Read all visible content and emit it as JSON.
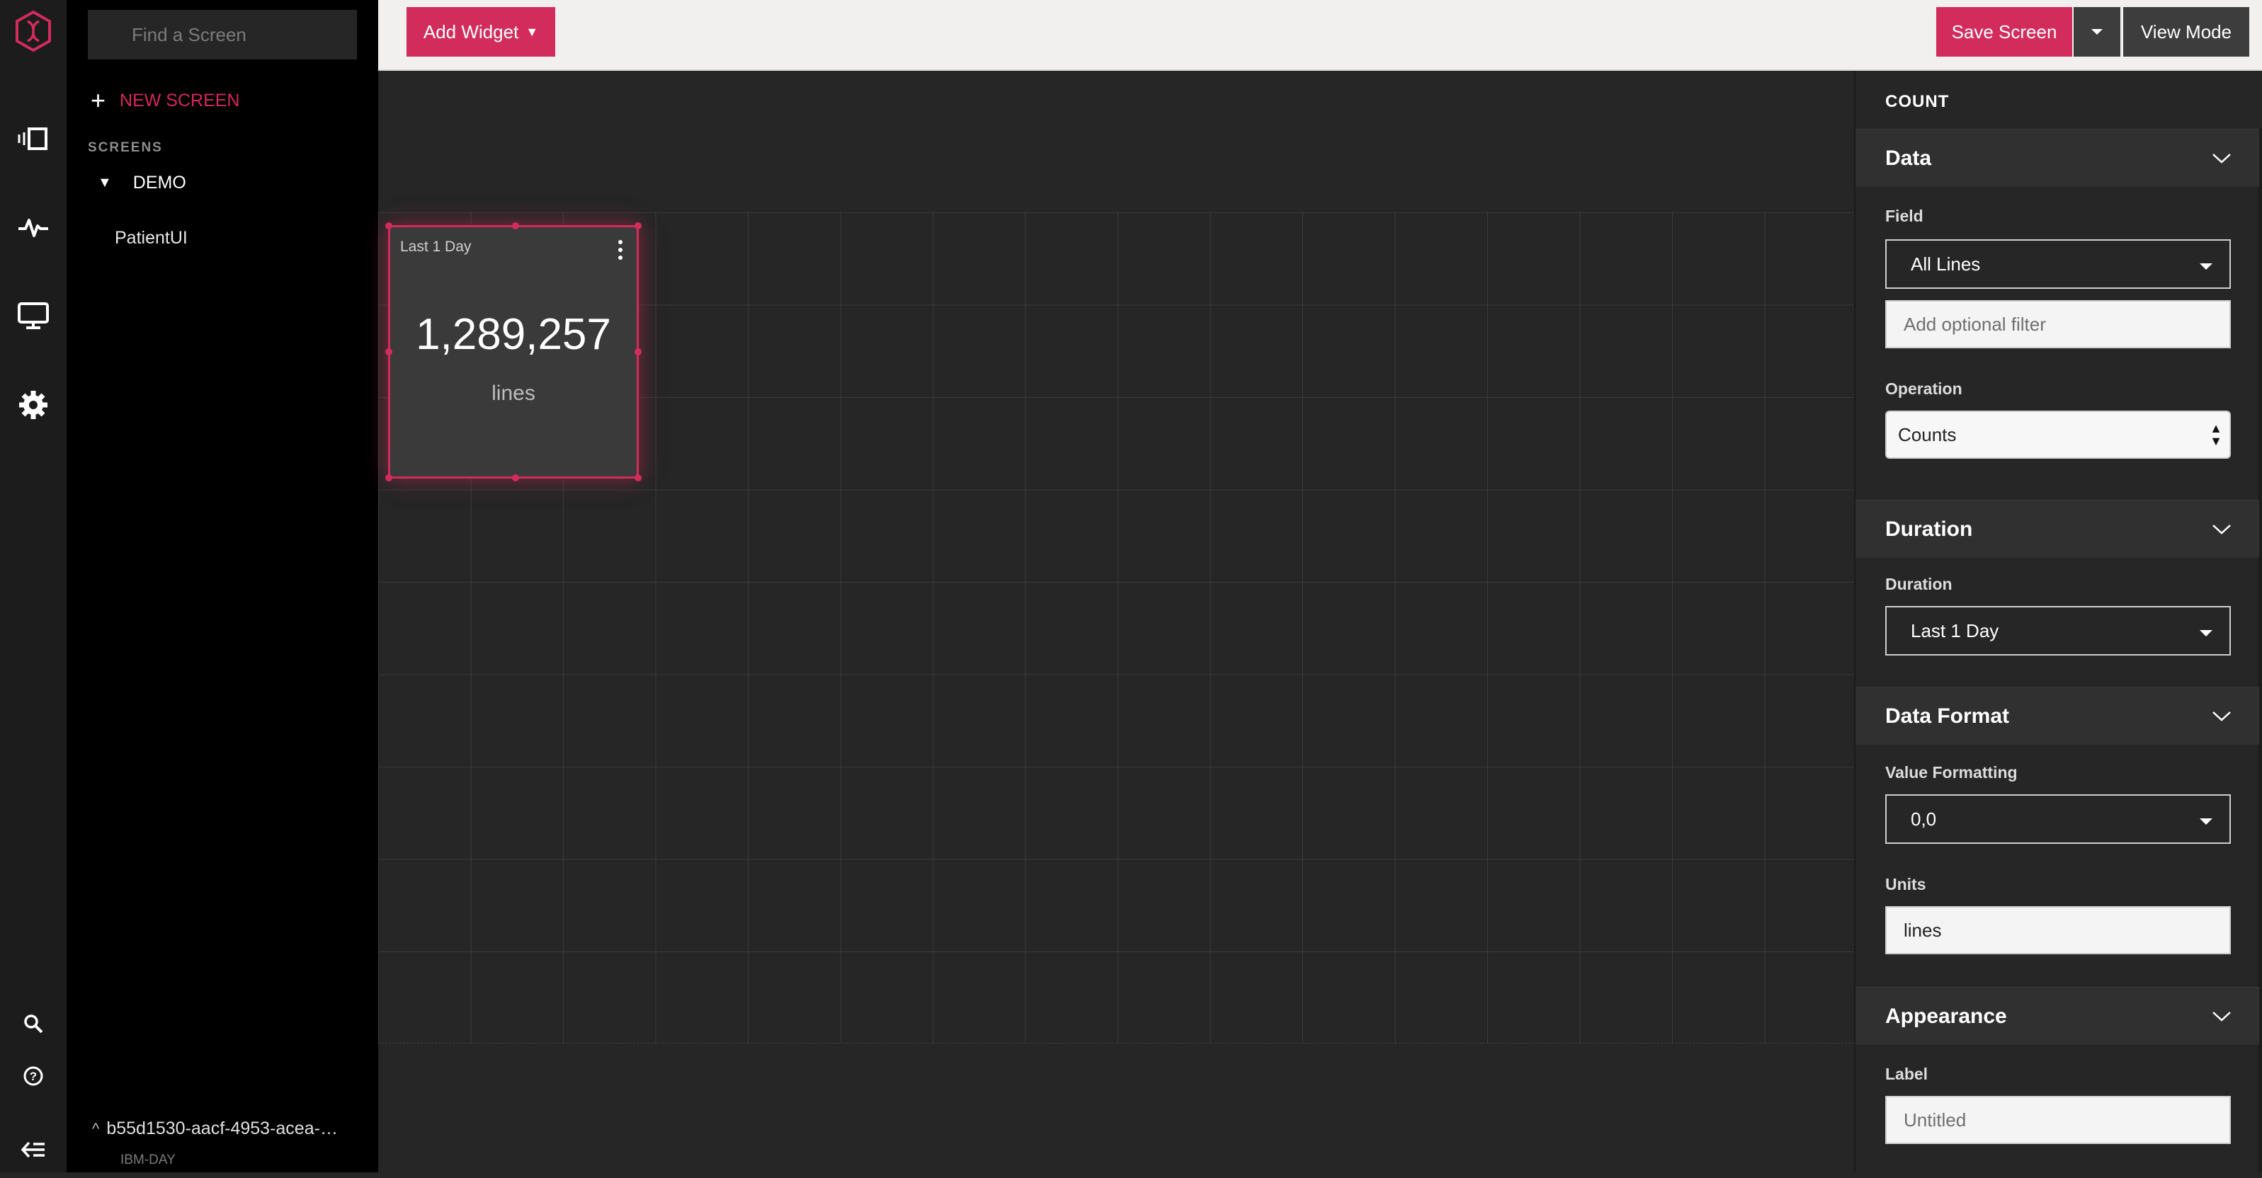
{
  "rail": {
    "icons": [
      "app-logo-icon",
      "screens-icon",
      "activity-icon",
      "monitor-icon",
      "settings-icon",
      "search-icon",
      "help-icon",
      "collapse-icon"
    ]
  },
  "nav": {
    "search_placeholder": "Find a Screen",
    "new_screen_label": "NEW SCREEN",
    "screens_heading": "SCREENS",
    "folder": "DEMO",
    "screen_item": "PatientUI",
    "tenant_id": "b55d1530-aacf-4953-acea-…",
    "tenant_org": "IBM-DAY"
  },
  "toolbar": {
    "add_widget": "Add Widget",
    "save_screen": "Save Screen",
    "view_mode": "View Mode"
  },
  "widget": {
    "duration": "Last 1 Day",
    "value": "1,289,257",
    "units": "lines"
  },
  "panel": {
    "title": "COUNT",
    "data": {
      "heading": "Data",
      "field_label": "Field",
      "field_value": "All Lines",
      "filter_placeholder": "Add optional filter",
      "operation_label": "Operation",
      "operation_value": "Counts"
    },
    "duration": {
      "heading": "Duration",
      "label": "Duration",
      "value": "Last 1 Day"
    },
    "data_format": {
      "heading": "Data Format",
      "value_formatting_label": "Value Formatting",
      "value_formatting": "0,0",
      "units_label": "Units",
      "units_value": "lines"
    },
    "appearance": {
      "heading": "Appearance",
      "label_label": "Label",
      "label_placeholder": "Untitled"
    }
  },
  "colors": {
    "accent": "#d22c5d",
    "rail_bg": "#1c1c1c",
    "nav_bg": "#000000",
    "canvas_bg": "#262626",
    "toolbar_bg": "#f1f0ee"
  }
}
